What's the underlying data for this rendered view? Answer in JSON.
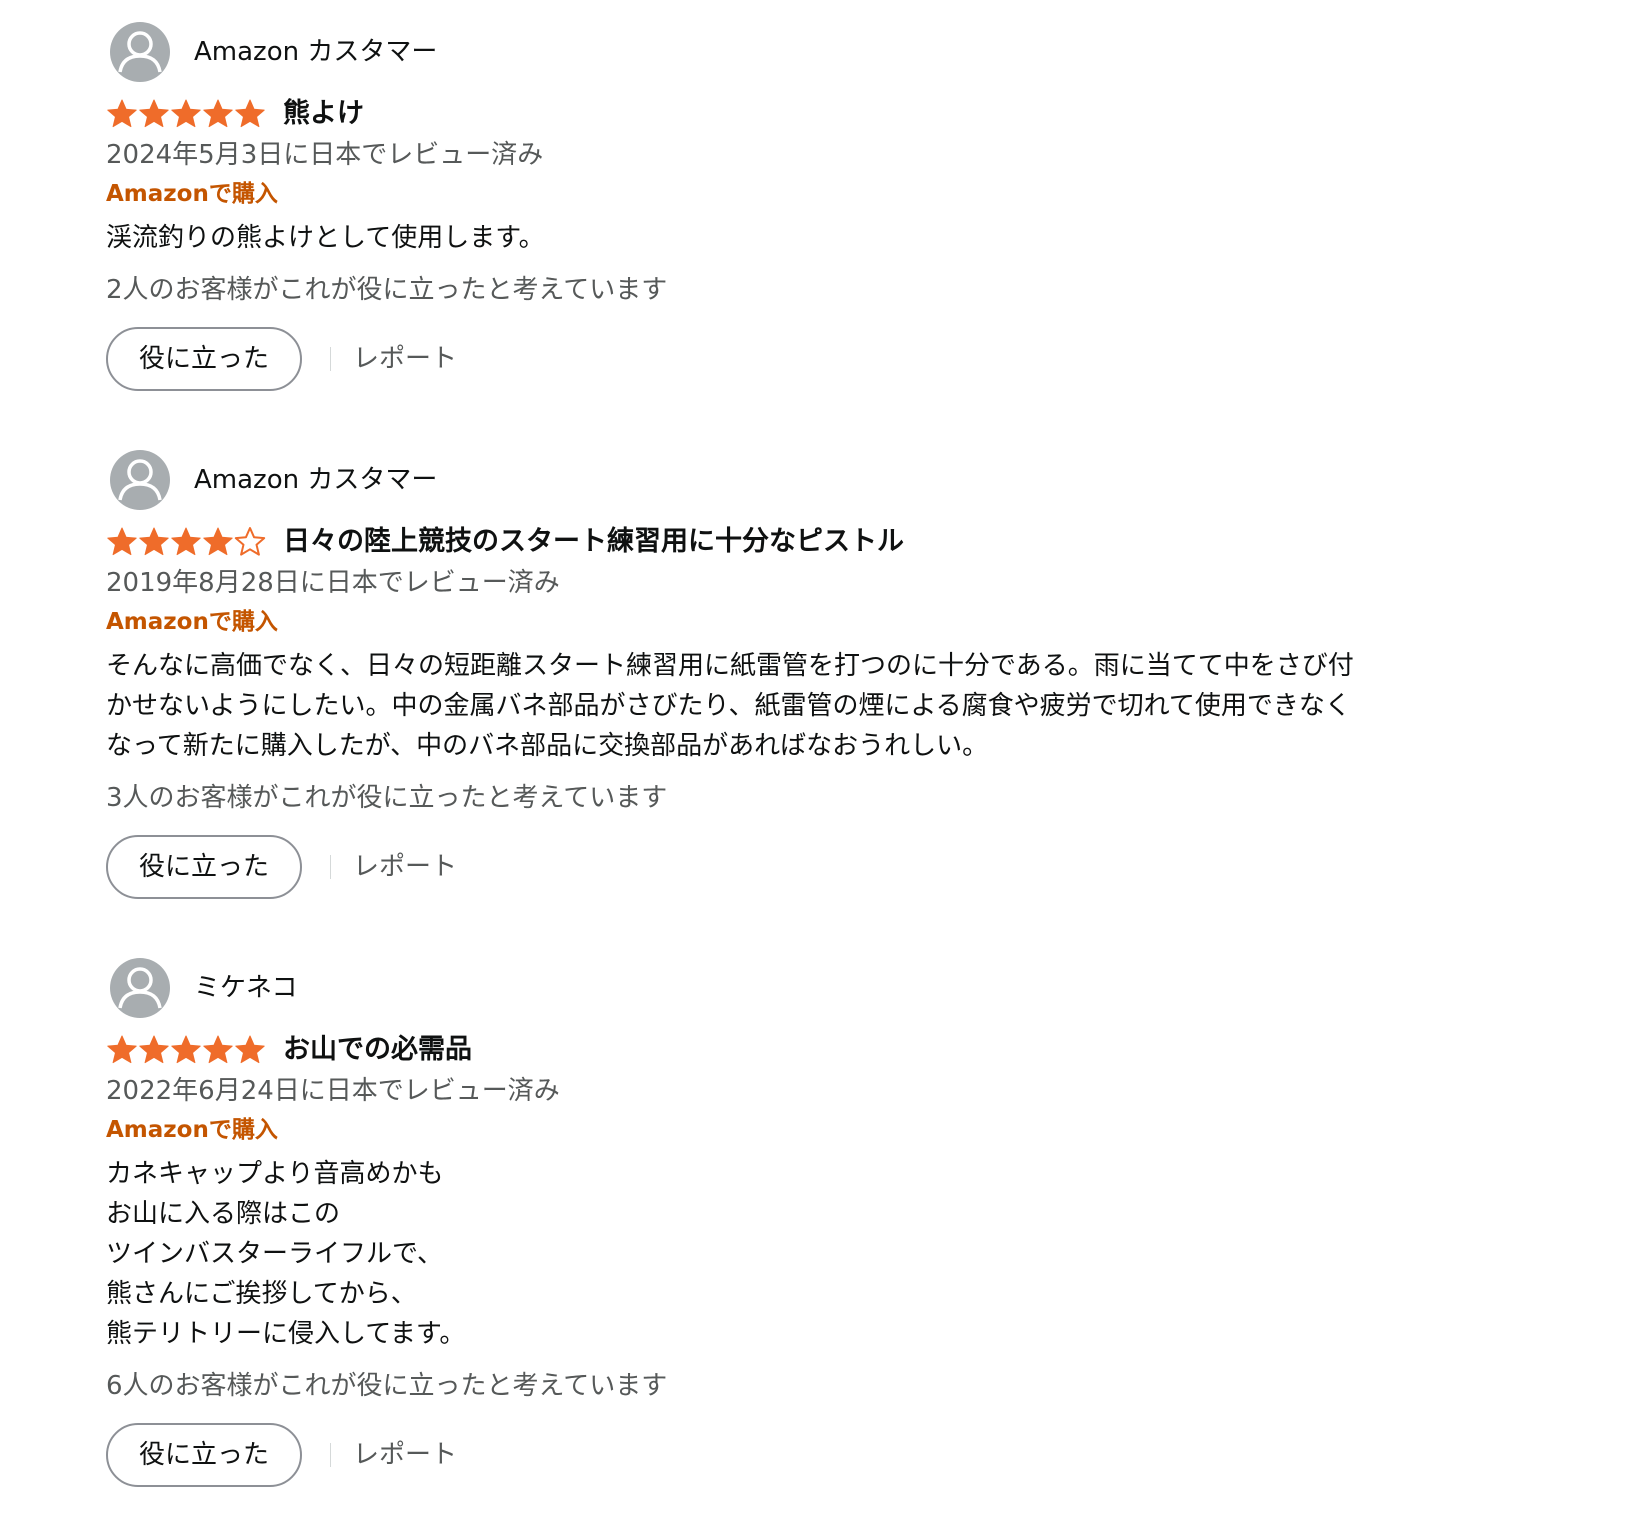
{
  "colors": {
    "star": "#ef6c2a",
    "verified": "#c45500",
    "muted_text": "#565959",
    "avatar": "#a8adb0"
  },
  "reviews": [
    {
      "profile_name": "Amazon カスタマー",
      "rating": 5,
      "rating_max": 5,
      "title": "熊よけ",
      "date": "2024年5月3日に日本でレビュー済み",
      "verified": "Amazonで購入",
      "body_lines": [
        "渓流釣りの熊よけとして使用します。"
      ],
      "helpful_count_text": "2人のお客様がこれが役に立ったと考えています",
      "helpful_button": "役に立った",
      "report_link": "レポート"
    },
    {
      "profile_name": "Amazon カスタマー",
      "rating": 4,
      "rating_max": 5,
      "title": "日々の陸上競技のスタート練習用に十分なピストル",
      "date": "2019年8月28日に日本でレビュー済み",
      "verified": "Amazonで購入",
      "body_lines": [
        "そんなに高価でなく、日々の短距離スタート練習用に紙雷管を打つのに十分である。雨に当てて中をさび付",
        "かせないようにしたい。中の金属バネ部品がさびたり、紙雷管の煙による腐食や疲労で切れて使用できなく",
        "なって新たに購入したが、中のバネ部品に交換部品があればなおうれしい。"
      ],
      "helpful_count_text": "3人のお客様がこれが役に立ったと考えています",
      "helpful_button": "役に立った",
      "report_link": "レポート"
    },
    {
      "profile_name": "ミケネコ",
      "rating": 5,
      "rating_max": 5,
      "title": "お山での必需品",
      "date": "2022年6月24日に日本でレビュー済み",
      "verified": "Amazonで購入",
      "body_lines": [
        "カネキャップより音高めかも",
        "お山に入る際はこの",
        "ツインバスターライフルで、",
        "熊さんにご挨拶してから、",
        "熊テリトリーに侵入してます。"
      ],
      "helpful_count_text": "6人のお客様がこれが役に立ったと考えています",
      "helpful_button": "役に立った",
      "report_link": "レポート"
    }
  ]
}
